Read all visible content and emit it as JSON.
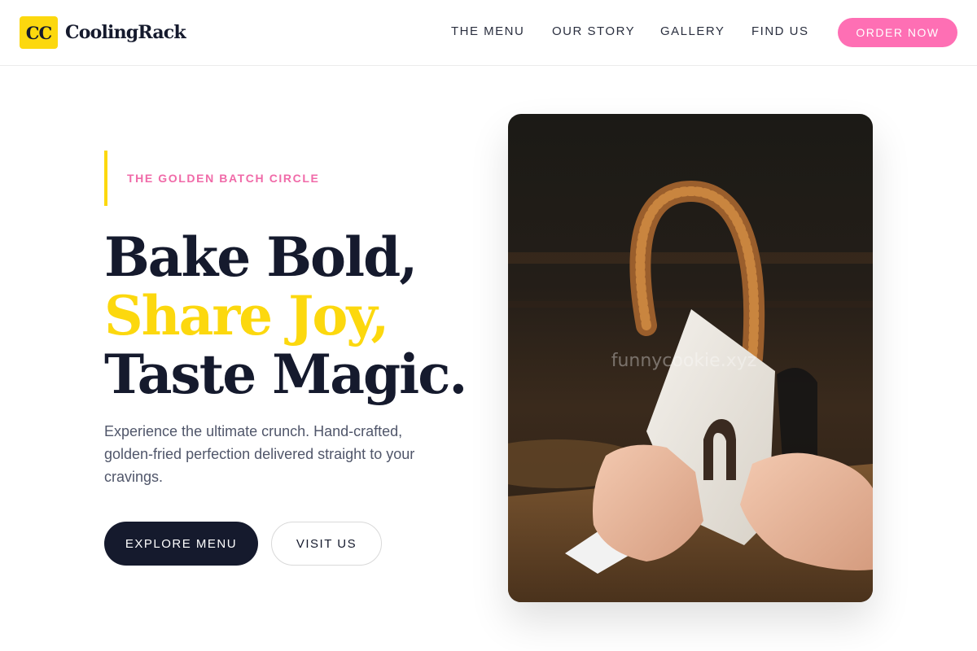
{
  "brand": {
    "logo_mark": "CC",
    "name": "CoolingRack"
  },
  "nav": {
    "items": [
      {
        "label": "THE MENU"
      },
      {
        "label": "OUR STORY"
      },
      {
        "label": "GALLERY"
      },
      {
        "label": "FIND US"
      }
    ],
    "cta_label": "ORDER NOW"
  },
  "hero": {
    "eyebrow": "THE GOLDEN BATCH CIRCLE",
    "headline": {
      "line1": "Bake Bold,",
      "line2": "Share Joy,",
      "line3": "Taste Magic."
    },
    "subtext": "Experience the ultimate crunch. Hand-crafted, golden-fried perfection delivered straight to your cravings.",
    "primary_button": "EXPLORE MENU",
    "secondary_button": "VISIT US",
    "image": {
      "subject": "hand-holding-churro-loop-photo",
      "watermark": "funnycookie.xyz"
    }
  },
  "colors": {
    "brand_yellow": "#fcd80e",
    "brand_pink": "#fe6fb4",
    "navy": "#151a2d",
    "body_text": "#50566a"
  }
}
